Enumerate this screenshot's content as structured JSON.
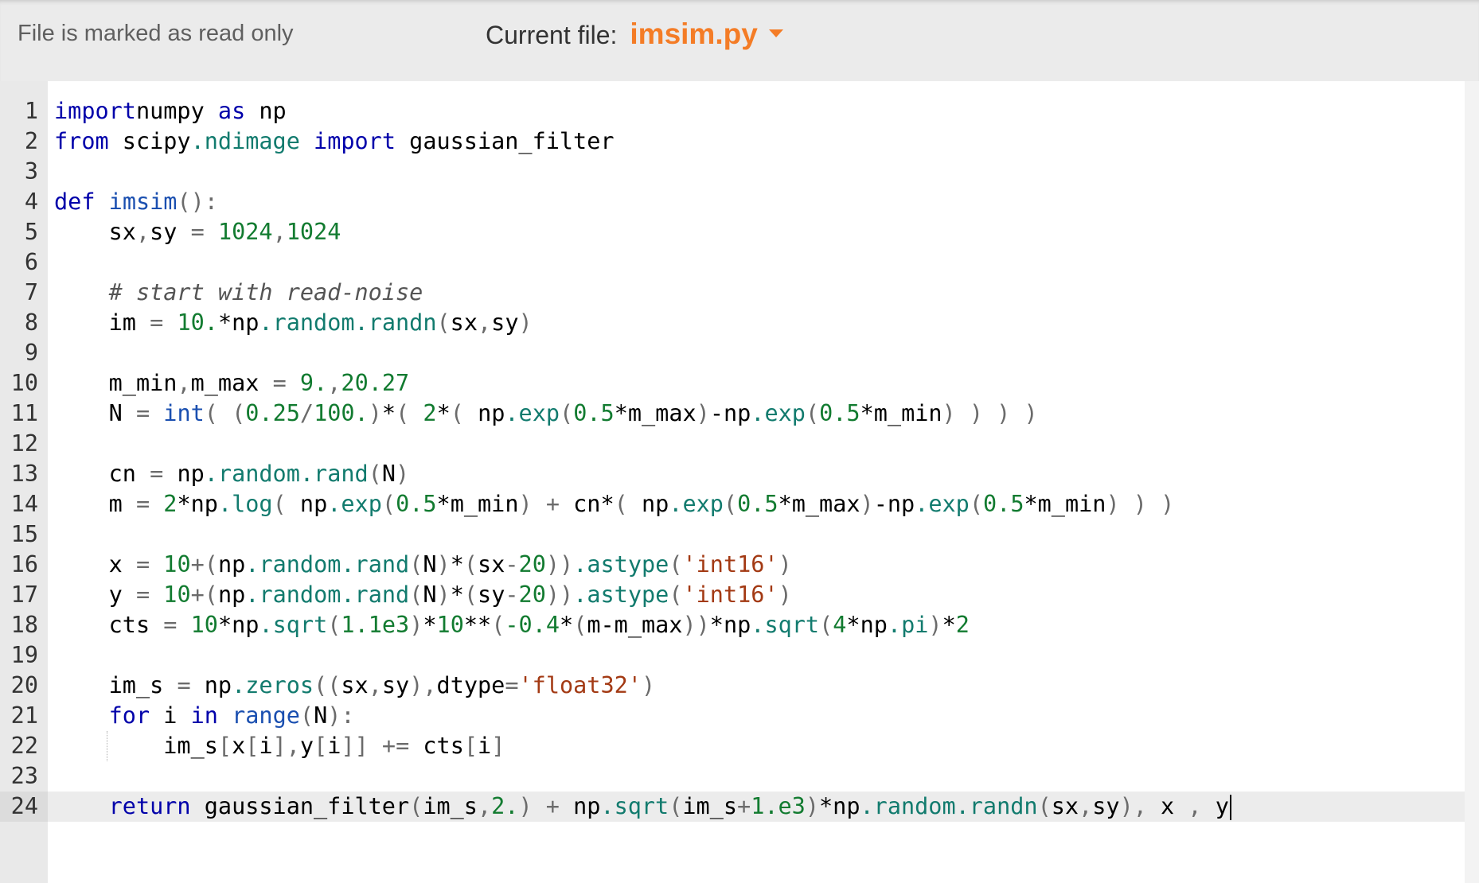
{
  "header": {
    "readonly_text": "File is marked as read only",
    "current_file_label": "Current file:",
    "current_file_name": "imsim.py"
  },
  "colors": {
    "accent": "#f47c26",
    "keyword": "#0000aa",
    "number": "#127b30",
    "string": "#a33a14"
  },
  "editor": {
    "active_line": 24,
    "lines": [
      {
        "n": "1",
        "t": [
          [
            "kw",
            "import"
          ],
          [
            "",
            "numpy "
          ],
          [
            "kw",
            "as"
          ],
          [
            "",
            " np"
          ]
        ]
      },
      {
        "n": "2",
        "t": [
          [
            "kw",
            "from"
          ],
          [
            "",
            " scipy"
          ],
          [
            "at",
            ".ndimage"
          ],
          [
            "",
            " "
          ],
          [
            "kw",
            "import"
          ],
          [
            "",
            " gaussian_filter"
          ]
        ]
      },
      {
        "n": "3",
        "t": []
      },
      {
        "n": "4",
        "t": [
          [
            "kw",
            "def"
          ],
          [
            "",
            " "
          ],
          [
            "fn",
            "imsim"
          ],
          [
            "op",
            "():"
          ]
        ]
      },
      {
        "n": "5",
        "t": [
          [
            "",
            "    sx"
          ],
          [
            "op",
            ","
          ],
          [
            "",
            "sy "
          ],
          [
            "op",
            "="
          ],
          [
            "",
            " "
          ],
          [
            "num-l",
            "1024"
          ],
          [
            "op",
            ","
          ],
          [
            "num-l",
            "1024"
          ]
        ]
      },
      {
        "n": "6",
        "t": []
      },
      {
        "n": "7",
        "t": [
          [
            "",
            "    "
          ],
          [
            "cmt",
            "# start with read-noise"
          ]
        ]
      },
      {
        "n": "8",
        "t": [
          [
            "",
            "    im "
          ],
          [
            "op",
            "="
          ],
          [
            "",
            " "
          ],
          [
            "num-l",
            "10."
          ],
          [
            "",
            "*np"
          ],
          [
            "at",
            ".random.randn"
          ],
          [
            "op",
            "("
          ],
          [
            "",
            "sx"
          ],
          [
            "op",
            ","
          ],
          [
            "",
            "sy"
          ],
          [
            "op",
            ")"
          ]
        ]
      },
      {
        "n": "9",
        "t": []
      },
      {
        "n": "10",
        "t": [
          [
            "",
            "    m_min"
          ],
          [
            "op",
            ","
          ],
          [
            "",
            "m_max "
          ],
          [
            "op",
            "="
          ],
          [
            "",
            " "
          ],
          [
            "num-l",
            "9."
          ],
          [
            "op",
            ","
          ],
          [
            "num-l",
            "20.27"
          ]
        ]
      },
      {
        "n": "11",
        "t": [
          [
            "",
            "    N "
          ],
          [
            "op",
            "="
          ],
          [
            "",
            " "
          ],
          [
            "fn",
            "int"
          ],
          [
            "op",
            "( ("
          ],
          [
            "num-l",
            "0.25"
          ],
          [
            "op",
            "/"
          ],
          [
            "num-l",
            "100."
          ],
          [
            "op",
            ")"
          ],
          [
            "",
            "*"
          ],
          [
            "op",
            "( "
          ],
          [
            "num-l",
            "2"
          ],
          [
            "",
            "*"
          ],
          [
            "op",
            "( "
          ],
          [
            "",
            "np"
          ],
          [
            "at",
            ".exp"
          ],
          [
            "op",
            "("
          ],
          [
            "num-l",
            "0.5"
          ],
          [
            "",
            "*m_max"
          ],
          [
            "op",
            ")"
          ],
          [
            "",
            "-np"
          ],
          [
            "at",
            ".exp"
          ],
          [
            "op",
            "("
          ],
          [
            "num-l",
            "0.5"
          ],
          [
            "",
            "*m_min"
          ],
          [
            "op",
            ") ) ) )"
          ]
        ]
      },
      {
        "n": "12",
        "t": []
      },
      {
        "n": "13",
        "t": [
          [
            "",
            "    cn "
          ],
          [
            "op",
            "="
          ],
          [
            "",
            " np"
          ],
          [
            "at",
            ".random.rand"
          ],
          [
            "op",
            "("
          ],
          [
            "",
            "N"
          ],
          [
            "op",
            ")"
          ]
        ]
      },
      {
        "n": "14",
        "t": [
          [
            "",
            "    m "
          ],
          [
            "op",
            "="
          ],
          [
            "",
            " "
          ],
          [
            "num-l",
            "2"
          ],
          [
            "",
            "*np"
          ],
          [
            "at",
            ".log"
          ],
          [
            "op",
            "( "
          ],
          [
            "",
            "np"
          ],
          [
            "at",
            ".exp"
          ],
          [
            "op",
            "("
          ],
          [
            "num-l",
            "0.5"
          ],
          [
            "",
            "*m_min"
          ],
          [
            "op",
            ") + "
          ],
          [
            "",
            "cn*"
          ],
          [
            "op",
            "( "
          ],
          [
            "",
            "np"
          ],
          [
            "at",
            ".exp"
          ],
          [
            "op",
            "("
          ],
          [
            "num-l",
            "0.5"
          ],
          [
            "",
            "*m_max"
          ],
          [
            "op",
            ")"
          ],
          [
            "",
            "-np"
          ],
          [
            "at",
            ".exp"
          ],
          [
            "op",
            "("
          ],
          [
            "num-l",
            "0.5"
          ],
          [
            "",
            "*m_min"
          ],
          [
            "op",
            ") ) )"
          ]
        ]
      },
      {
        "n": "15",
        "t": []
      },
      {
        "n": "16",
        "t": [
          [
            "",
            "    x "
          ],
          [
            "op",
            "="
          ],
          [
            "",
            " "
          ],
          [
            "num-l",
            "10"
          ],
          [
            "op",
            "+("
          ],
          [
            "",
            "np"
          ],
          [
            "at",
            ".random.rand"
          ],
          [
            "op",
            "("
          ],
          [
            "",
            "N"
          ],
          [
            "op",
            ")"
          ],
          [
            "",
            "*"
          ],
          [
            "op",
            "("
          ],
          [
            "",
            "sx"
          ],
          [
            "op",
            "-"
          ],
          [
            "num-l",
            "20"
          ],
          [
            "op",
            "))"
          ],
          [
            "at",
            ".astype"
          ],
          [
            "op",
            "("
          ],
          [
            "str",
            "'int16'"
          ],
          [
            "op",
            ")"
          ]
        ]
      },
      {
        "n": "17",
        "t": [
          [
            "",
            "    y "
          ],
          [
            "op",
            "="
          ],
          [
            "",
            " "
          ],
          [
            "num-l",
            "10"
          ],
          [
            "op",
            "+("
          ],
          [
            "",
            "np"
          ],
          [
            "at",
            ".random.rand"
          ],
          [
            "op",
            "("
          ],
          [
            "",
            "N"
          ],
          [
            "op",
            ")"
          ],
          [
            "",
            "*"
          ],
          [
            "op",
            "("
          ],
          [
            "",
            "sy"
          ],
          [
            "op",
            "-"
          ],
          [
            "num-l",
            "20"
          ],
          [
            "op",
            "))"
          ],
          [
            "at",
            ".astype"
          ],
          [
            "op",
            "("
          ],
          [
            "str",
            "'int16'"
          ],
          [
            "op",
            ")"
          ]
        ]
      },
      {
        "n": "18",
        "t": [
          [
            "",
            "    cts "
          ],
          [
            "op",
            "="
          ],
          [
            "",
            " "
          ],
          [
            "num-l",
            "10"
          ],
          [
            "",
            "*np"
          ],
          [
            "at",
            ".sqrt"
          ],
          [
            "op",
            "("
          ],
          [
            "num-l",
            "1.1e3"
          ],
          [
            "op",
            ")"
          ],
          [
            "",
            "*"
          ],
          [
            "num-l",
            "10"
          ],
          [
            "",
            "**"
          ],
          [
            "op",
            "("
          ],
          [
            "num-l",
            "-0.4"
          ],
          [
            "",
            "*"
          ],
          [
            "op",
            "("
          ],
          [
            "",
            "m-m_max"
          ],
          [
            "op",
            "))"
          ],
          [
            "",
            "*np"
          ],
          [
            "at",
            ".sqrt"
          ],
          [
            "op",
            "("
          ],
          [
            "num-l",
            "4"
          ],
          [
            "",
            "*np"
          ],
          [
            "at",
            ".pi"
          ],
          [
            "op",
            ")"
          ],
          [
            "",
            "*"
          ],
          [
            "num-l",
            "2"
          ]
        ]
      },
      {
        "n": "19",
        "t": []
      },
      {
        "n": "20",
        "t": [
          [
            "",
            "    im_s "
          ],
          [
            "op",
            "="
          ],
          [
            "",
            " np"
          ],
          [
            "at",
            ".zeros"
          ],
          [
            "op",
            "(("
          ],
          [
            "",
            "sx"
          ],
          [
            "op",
            ","
          ],
          [
            "",
            "sy"
          ],
          [
            "op",
            "),"
          ],
          [
            "",
            "dtype"
          ],
          [
            "op",
            "="
          ],
          [
            "str",
            "'float32'"
          ],
          [
            "op",
            ")"
          ]
        ]
      },
      {
        "n": "21",
        "t": [
          [
            "",
            "    "
          ],
          [
            "kw",
            "for"
          ],
          [
            "",
            " i "
          ],
          [
            "kw",
            "in"
          ],
          [
            "",
            " "
          ],
          [
            "fn",
            "range"
          ],
          [
            "op",
            "("
          ],
          [
            "",
            "N"
          ],
          [
            "op",
            "):"
          ]
        ]
      },
      {
        "n": "22",
        "t": [
          [
            "",
            "        im_s"
          ],
          [
            "op",
            "["
          ],
          [
            "",
            "x"
          ],
          [
            "op",
            "["
          ],
          [
            "",
            "i"
          ],
          [
            "op",
            "],"
          ],
          [
            "",
            "y"
          ],
          [
            "op",
            "["
          ],
          [
            "",
            "i"
          ],
          [
            "op",
            "]] += "
          ],
          [
            "",
            "cts"
          ],
          [
            "op",
            "["
          ],
          [
            "",
            "i"
          ],
          [
            "op",
            "]"
          ]
        ]
      },
      {
        "n": "23",
        "t": []
      },
      {
        "n": "24",
        "t": [
          [
            "",
            "    "
          ],
          [
            "kw",
            "return"
          ],
          [
            "",
            " gaussian_filter"
          ],
          [
            "op",
            "("
          ],
          [
            "",
            "im_s"
          ],
          [
            "op",
            ","
          ],
          [
            "num-l",
            "2."
          ],
          [
            "op",
            ") + "
          ],
          [
            "",
            "np"
          ],
          [
            "at",
            ".sqrt"
          ],
          [
            "op",
            "("
          ],
          [
            "",
            "im_s"
          ],
          [
            "op",
            "+"
          ],
          [
            "num-l",
            "1.e3"
          ],
          [
            "op",
            ")"
          ],
          [
            "",
            "*np"
          ],
          [
            "at",
            ".random.randn"
          ],
          [
            "op",
            "("
          ],
          [
            "",
            "sx"
          ],
          [
            "op",
            ","
          ],
          [
            "",
            "sy"
          ],
          [
            "op",
            "), "
          ],
          [
            "",
            "x "
          ],
          [
            "op",
            ","
          ],
          [
            "",
            " y"
          ]
        ]
      }
    ]
  }
}
